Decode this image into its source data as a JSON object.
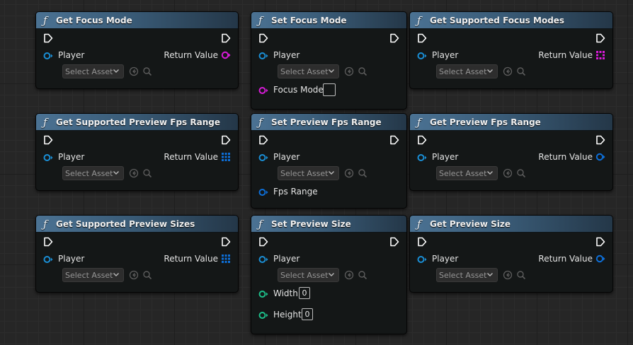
{
  "nodes": [
    {
      "title": "Get Focus Mode",
      "player": "Player",
      "select_asset": "Select Asset",
      "return_label": "Return Value",
      "return_type": "enum-pin",
      "return_color": "#d91bd9"
    },
    {
      "title": "Set Focus Mode",
      "player": "Player",
      "select_asset": "Select Asset",
      "param_label": "Focus Mode",
      "param_type": "enum-pin",
      "param_color": "#d91bd9"
    },
    {
      "title": "Get Supported Focus Modes",
      "player": "Player",
      "select_asset": "Select Asset",
      "return_label": "Return Value",
      "return_type": "array-pin",
      "return_color": "#d91bd9"
    },
    {
      "title": "Get Supported Preview Fps Range",
      "player": "Player",
      "select_asset": "Select Asset",
      "return_label": "Return Value",
      "return_type": "array-pin",
      "return_color": "#0d6fd9"
    },
    {
      "title": "Set Preview Fps Range",
      "player": "Player",
      "select_asset": "Select Asset",
      "param_label": "Fps Range",
      "param_type": "struct-pin",
      "param_color": "#0d6fd9"
    },
    {
      "title": "Get Preview Fps Range",
      "player": "Player",
      "select_asset": "Select Asset",
      "return_label": "Return Value",
      "return_type": "struct-pin",
      "return_color": "#0d6fd9"
    },
    {
      "title": "Get Supported Preview Sizes",
      "player": "Player",
      "select_asset": "Select Asset",
      "return_label": "Return Value",
      "return_type": "array-pin",
      "return_color": "#0d6fd9"
    },
    {
      "title": "Set Preview Size",
      "player": "Player",
      "select_asset": "Select Asset",
      "width_label": "Width",
      "width_value": "0",
      "height_label": "Height",
      "height_value": "0",
      "param_color": "#1dbf8a"
    },
    {
      "title": "Get Preview Size",
      "player": "Player",
      "select_asset": "Select Asset",
      "return_label": "Return Value",
      "return_type": "struct-pin",
      "return_color": "#0d6fd9"
    }
  ],
  "colors": {
    "object_pin": "#1a8fd6",
    "header_blue": "#4b7293",
    "exec_pin": "#ffffff"
  },
  "icons": {
    "function": "function-icon",
    "exec": "exec-pin-icon",
    "object": "object-pin-icon",
    "use_selected": "use-selected-asset-icon",
    "browse": "browse-asset-icon",
    "dropdown": "chevron-down-icon"
  }
}
